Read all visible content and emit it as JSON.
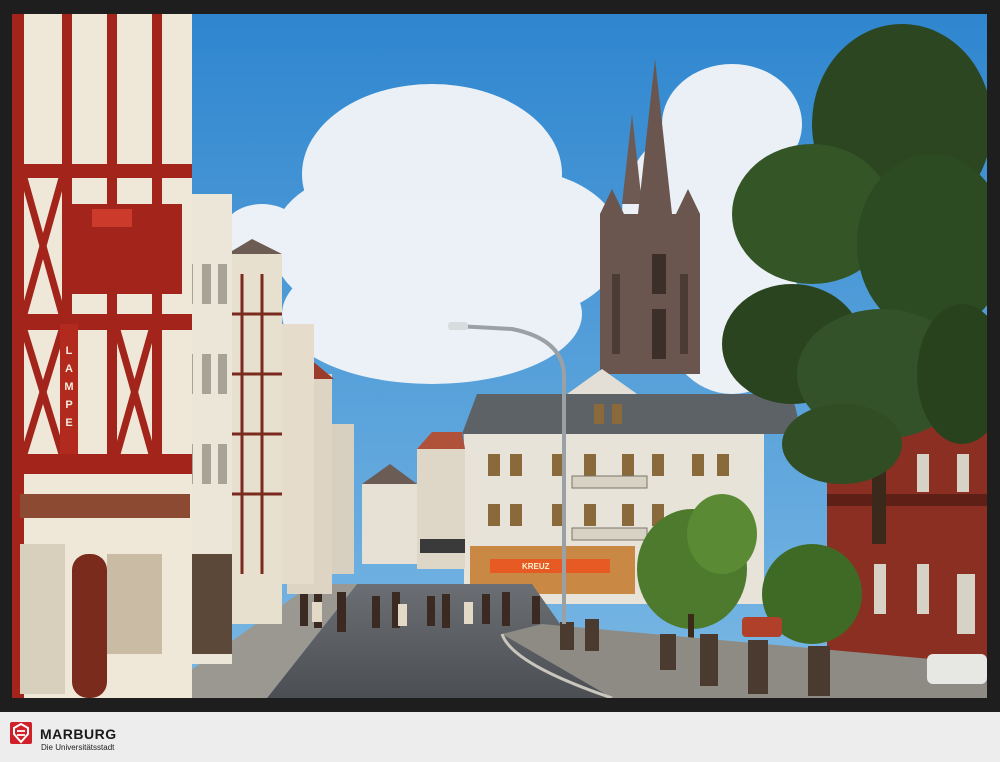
{
  "photo": {
    "description_icon": "postcard-photo",
    "shop_sign_vertical": "LAMPE",
    "shop_sign_awning": "KREUZ"
  },
  "footer": {
    "brand_title": "MARBURG",
    "brand_subtitle": "Die Universitätsstadt",
    "brand_color": "#d0202a"
  }
}
